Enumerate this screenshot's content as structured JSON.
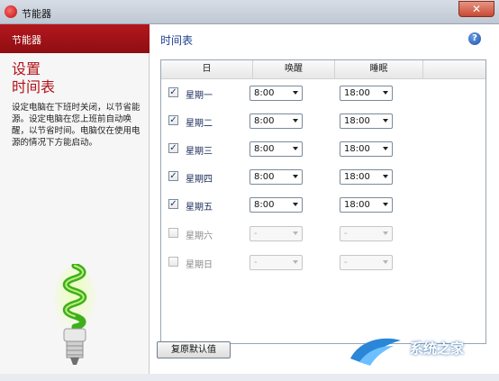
{
  "window": {
    "title": "节能器",
    "close_glyph": "✕"
  },
  "sidebar": {
    "header": "节能器",
    "title": "设置\n时间表",
    "description": "设定电脑在下班时关闭，以节省能源。设定电脑在您上班前自动唤醒，以节省时间。电脑仅在使用电源的情况下方能启动。"
  },
  "main": {
    "title": "时间表",
    "help_glyph": "?",
    "columns": {
      "day": "日",
      "wake": "唤醒",
      "sleep": "睡眠"
    },
    "rows": [
      {
        "day": "星期一",
        "checked": true,
        "check_glyph": "✓",
        "wake": "8:00",
        "sleep": "18:00"
      },
      {
        "day": "星期二",
        "checked": true,
        "check_glyph": "✓",
        "wake": "8:00",
        "sleep": "18:00"
      },
      {
        "day": "星期三",
        "checked": true,
        "check_glyph": "✓",
        "wake": "8:00",
        "sleep": "18:00"
      },
      {
        "day": "星期四",
        "checked": true,
        "check_glyph": "✓",
        "wake": "8:00",
        "sleep": "18:00"
      },
      {
        "day": "星期五",
        "checked": true,
        "check_glyph": "✓",
        "wake": "8:00",
        "sleep": "18:00"
      },
      {
        "day": "星期六",
        "checked": false,
        "check_glyph": "",
        "wake": "-",
        "sleep": "-"
      },
      {
        "day": "星期日",
        "checked": false,
        "check_glyph": "",
        "wake": "-",
        "sleep": "-"
      }
    ],
    "restore_button": "复原默认值"
  },
  "watermark": {
    "text": "系统之家"
  },
  "colors": {
    "accent": "#b0141a",
    "title_blue": "#1e3f8f"
  }
}
